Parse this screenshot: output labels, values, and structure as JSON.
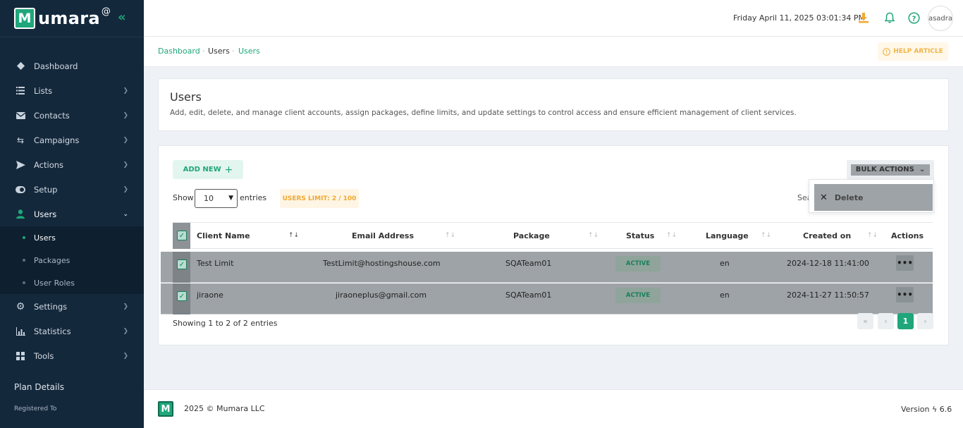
{
  "brand": {
    "logo_letter": "M",
    "name": "umara",
    "at": "@",
    "accent": "#1fa67a"
  },
  "sidebar": {
    "items": [
      {
        "label": "Dashboard"
      },
      {
        "label": "Lists"
      },
      {
        "label": "Contacts"
      },
      {
        "label": "Campaigns"
      },
      {
        "label": "Actions"
      },
      {
        "label": "Setup"
      },
      {
        "label": "Users"
      },
      {
        "label": "Settings"
      },
      {
        "label": "Statistics"
      },
      {
        "label": "Tools"
      }
    ],
    "sub_items": [
      {
        "label": "Users"
      },
      {
        "label": "Packages"
      },
      {
        "label": "User Roles"
      }
    ],
    "plan_details": "Plan Details",
    "registered_to": "Registered To"
  },
  "header": {
    "datetime": "Friday April 11, 2025 03:01:34 PM",
    "avatar_alt": "asadra"
  },
  "breadcrumb": {
    "items": [
      "Dashboard",
      "Users",
      "Users"
    ],
    "sep": "·"
  },
  "help_article": "HELP ARTICLE",
  "page": {
    "title": "Users",
    "description": "Add, edit, delete, and manage client accounts, assign packages, define limits, and update settings to control access and ensure efficient management of client services."
  },
  "toolbar": {
    "add_new": "ADD NEW",
    "show_label": "Show",
    "entries_value": "10",
    "entries_label": "entries",
    "users_limit": "USERS LIMIT: 2 / 100",
    "search_label": "Sea",
    "bulk_actions": "BULK ACTIONS",
    "bulk_menu": [
      "Delete"
    ]
  },
  "table": {
    "columns": [
      "Client Name",
      "Email Address",
      "Package",
      "Status",
      "Language",
      "Created on",
      "Actions"
    ],
    "rows": [
      {
        "name": "Test Limit",
        "email": "TestLimit@hostingshouse.com",
        "package": "SQATeam01",
        "status": "ACTIVE",
        "language": "en",
        "created": "2024-12-18 11:41:00",
        "actions": "•••"
      },
      {
        "name": "jiraone",
        "email": "jiraoneplus@gmail.com",
        "package": "SQATeam01",
        "status": "ACTIVE",
        "language": "en",
        "created": "2024-11-27 11:50:57",
        "actions": "•••"
      }
    ]
  },
  "pagination": {
    "showing_prefix": "Showing",
    "showing_range": "1 to 2 of 2 entries",
    "pages": [
      "«",
      "‹",
      "1",
      "›"
    ]
  },
  "footer": {
    "copyright": "2025 © Mumara LLC",
    "version_label": "Version",
    "version": "6.6"
  }
}
